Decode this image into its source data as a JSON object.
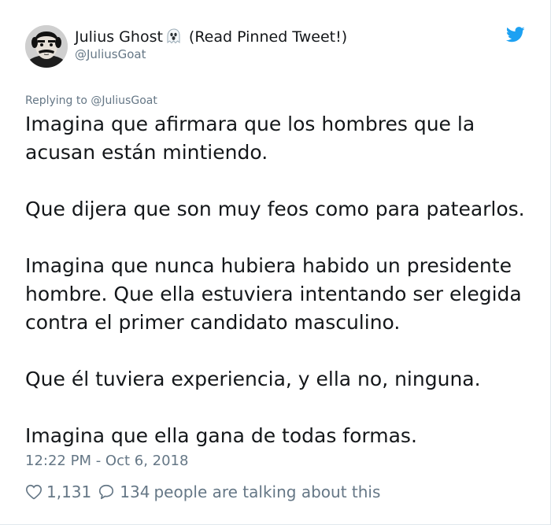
{
  "author": {
    "display_name": "Julius Ghost",
    "emoji": "ghost-emoji",
    "pinned_note": "(Read Pinned Tweet!)",
    "handle": "@JuliusGoat",
    "avatar": "avatar-photo"
  },
  "platform": {
    "icon": "twitter-bird-icon",
    "brand_color": "#1da1f2"
  },
  "reply": {
    "prefix": "Replying to",
    "target": "@JuliusGoat"
  },
  "tweet": {
    "paragraphs": [
      "Imagina que afirmara que los hombres que la acusan están mintiendo.",
      "Que dijera que son muy feos como para patearlos.",
      "Imagina que nunca hubiera habido un presidente hombre. Que ella estuviera intentando ser elegida contra el primer candidato masculino.",
      "Que él tuviera experiencia, y ella no, ninguna.",
      "Imagina que ella gana de todas formas."
    ],
    "timestamp": "12:22 PM - Oct 6, 2018"
  },
  "engagement": {
    "likes": "1,131",
    "like_icon": "heart-icon",
    "replies": "134",
    "reply_icon": "speech-bubble-icon",
    "talking_text": "people are talking about this"
  },
  "colors": {
    "text_primary": "#14171a",
    "text_secondary": "#657786",
    "border": "#e1e8ed"
  }
}
